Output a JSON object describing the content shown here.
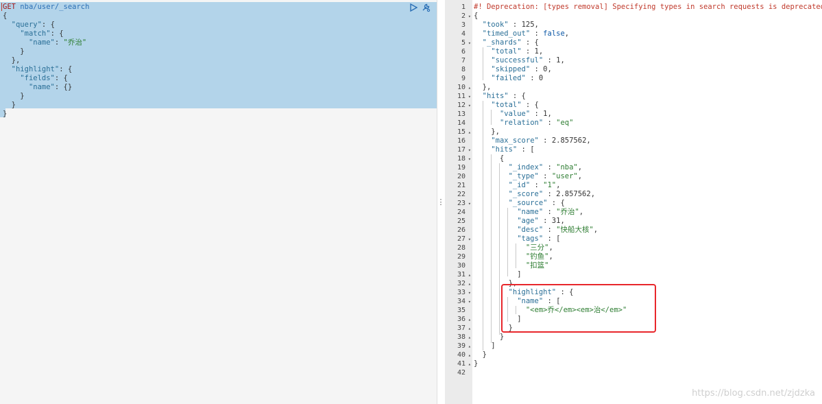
{
  "request": {
    "method": "GET",
    "url": "nba/user/_search",
    "lines": [
      [
        [
          "pun",
          "{"
        ]
      ],
      [
        [
          "pun",
          "  "
        ],
        [
          "key",
          "\"query\""
        ],
        [
          "pun",
          ": {"
        ]
      ],
      [
        [
          "pun",
          "    "
        ],
        [
          "key",
          "\"match\""
        ],
        [
          "pun",
          ": {"
        ]
      ],
      [
        [
          "pun",
          "      "
        ],
        [
          "key",
          "\"name\""
        ],
        [
          "pun",
          ": "
        ],
        [
          "str",
          "\"乔治\""
        ]
      ],
      [
        [
          "pun",
          "    }"
        ]
      ],
      [
        [
          "pun",
          "  },"
        ]
      ],
      [
        [
          "pun",
          "  "
        ],
        [
          "key",
          "\"highlight\""
        ],
        [
          "pun",
          ": {"
        ]
      ],
      [
        [
          "pun",
          "    "
        ],
        [
          "key",
          "\"fields\""
        ],
        [
          "pun",
          ": {"
        ]
      ],
      [
        [
          "pun",
          "      "
        ],
        [
          "key",
          "\"name\""
        ],
        [
          "pun",
          ": {}"
        ]
      ],
      [
        [
          "pun",
          "    }"
        ]
      ],
      [
        [
          "pun",
          "  }"
        ]
      ],
      [
        [
          "pun",
          "}"
        ]
      ]
    ]
  },
  "actions": {
    "run_icon": "play-icon",
    "settings_icon": "wrench-icon"
  },
  "splitter_glyph": "⋮",
  "response": {
    "lines": [
      {
        "n": "1",
        "fold": "",
        "t": [
          [
            "comment",
            "#! Deprecation: [types removal] Specifying types in search requests is deprecated."
          ]
        ]
      },
      {
        "n": "2",
        "fold": "▾",
        "t": [
          [
            "pun",
            "{"
          ]
        ]
      },
      {
        "n": "3",
        "fold": "",
        "t": [
          [
            "pun",
            "  "
          ],
          [
            "key",
            "\"took\""
          ],
          [
            "pun",
            " : "
          ],
          [
            "num",
            "125"
          ],
          [
            "pun",
            ","
          ]
        ]
      },
      {
        "n": "4",
        "fold": "",
        "t": [
          [
            "pun",
            "  "
          ],
          [
            "key",
            "\"timed_out\""
          ],
          [
            "pun",
            " : "
          ],
          [
            "bool",
            "false"
          ],
          [
            "pun",
            ","
          ]
        ]
      },
      {
        "n": "5",
        "fold": "▾",
        "t": [
          [
            "pun",
            "  "
          ],
          [
            "key",
            "\"_shards\""
          ],
          [
            "pun",
            " : {"
          ]
        ]
      },
      {
        "n": "6",
        "fold": "",
        "t": [
          [
            "pun",
            "    "
          ],
          [
            "key",
            "\"total\""
          ],
          [
            "pun",
            " : "
          ],
          [
            "num",
            "1"
          ],
          [
            "pun",
            ","
          ]
        ]
      },
      {
        "n": "7",
        "fold": "",
        "t": [
          [
            "pun",
            "    "
          ],
          [
            "key",
            "\"successful\""
          ],
          [
            "pun",
            " : "
          ],
          [
            "num",
            "1"
          ],
          [
            "pun",
            ","
          ]
        ]
      },
      {
        "n": "8",
        "fold": "",
        "t": [
          [
            "pun",
            "    "
          ],
          [
            "key",
            "\"skipped\""
          ],
          [
            "pun",
            " : "
          ],
          [
            "num",
            "0"
          ],
          [
            "pun",
            ","
          ]
        ]
      },
      {
        "n": "9",
        "fold": "",
        "t": [
          [
            "pun",
            "    "
          ],
          [
            "key",
            "\"failed\""
          ],
          [
            "pun",
            " : "
          ],
          [
            "num",
            "0"
          ]
        ]
      },
      {
        "n": "10",
        "fold": "▴",
        "t": [
          [
            "pun",
            "  },"
          ]
        ]
      },
      {
        "n": "11",
        "fold": "▾",
        "t": [
          [
            "pun",
            "  "
          ],
          [
            "key",
            "\"hits\""
          ],
          [
            "pun",
            " : {"
          ]
        ]
      },
      {
        "n": "12",
        "fold": "▾",
        "t": [
          [
            "pun",
            "    "
          ],
          [
            "key",
            "\"total\""
          ],
          [
            "pun",
            " : {"
          ]
        ]
      },
      {
        "n": "13",
        "fold": "",
        "t": [
          [
            "pun",
            "      "
          ],
          [
            "key",
            "\"value\""
          ],
          [
            "pun",
            " : "
          ],
          [
            "num",
            "1"
          ],
          [
            "pun",
            ","
          ]
        ]
      },
      {
        "n": "14",
        "fold": "",
        "t": [
          [
            "pun",
            "      "
          ],
          [
            "key",
            "\"relation\""
          ],
          [
            "pun",
            " : "
          ],
          [
            "str",
            "\"eq\""
          ]
        ]
      },
      {
        "n": "15",
        "fold": "▴",
        "t": [
          [
            "pun",
            "    },"
          ]
        ]
      },
      {
        "n": "16",
        "fold": "",
        "t": [
          [
            "pun",
            "    "
          ],
          [
            "key",
            "\"max_score\""
          ],
          [
            "pun",
            " : "
          ],
          [
            "num",
            "2.857562"
          ],
          [
            "pun",
            ","
          ]
        ]
      },
      {
        "n": "17",
        "fold": "▾",
        "t": [
          [
            "pun",
            "    "
          ],
          [
            "key",
            "\"hits\""
          ],
          [
            "pun",
            " : ["
          ]
        ]
      },
      {
        "n": "18",
        "fold": "▾",
        "t": [
          [
            "pun",
            "      {"
          ]
        ]
      },
      {
        "n": "19",
        "fold": "",
        "t": [
          [
            "pun",
            "        "
          ],
          [
            "key",
            "\"_index\""
          ],
          [
            "pun",
            " : "
          ],
          [
            "str",
            "\"nba\""
          ],
          [
            "pun",
            ","
          ]
        ]
      },
      {
        "n": "20",
        "fold": "",
        "t": [
          [
            "pun",
            "        "
          ],
          [
            "key",
            "\"_type\""
          ],
          [
            "pun",
            " : "
          ],
          [
            "str",
            "\"user\""
          ],
          [
            "pun",
            ","
          ]
        ]
      },
      {
        "n": "21",
        "fold": "",
        "t": [
          [
            "pun",
            "        "
          ],
          [
            "key",
            "\"_id\""
          ],
          [
            "pun",
            " : "
          ],
          [
            "str",
            "\"1\""
          ],
          [
            "pun",
            ","
          ]
        ]
      },
      {
        "n": "22",
        "fold": "",
        "t": [
          [
            "pun",
            "        "
          ],
          [
            "key",
            "\"_score\""
          ],
          [
            "pun",
            " : "
          ],
          [
            "num",
            "2.857562"
          ],
          [
            "pun",
            ","
          ]
        ]
      },
      {
        "n": "23",
        "fold": "▾",
        "t": [
          [
            "pun",
            "        "
          ],
          [
            "key",
            "\"_source\""
          ],
          [
            "pun",
            " : {"
          ]
        ]
      },
      {
        "n": "24",
        "fold": "",
        "t": [
          [
            "pun",
            "          "
          ],
          [
            "key",
            "\"name\""
          ],
          [
            "pun",
            " : "
          ],
          [
            "str",
            "\"乔治\""
          ],
          [
            "pun",
            ","
          ]
        ]
      },
      {
        "n": "25",
        "fold": "",
        "t": [
          [
            "pun",
            "          "
          ],
          [
            "key",
            "\"age\""
          ],
          [
            "pun",
            " : "
          ],
          [
            "num",
            "31"
          ],
          [
            "pun",
            ","
          ]
        ]
      },
      {
        "n": "26",
        "fold": "",
        "t": [
          [
            "pun",
            "          "
          ],
          [
            "key",
            "\"desc\""
          ],
          [
            "pun",
            " : "
          ],
          [
            "str",
            "\"快船大核\""
          ],
          [
            "pun",
            ","
          ]
        ]
      },
      {
        "n": "27",
        "fold": "▾",
        "t": [
          [
            "pun",
            "          "
          ],
          [
            "key",
            "\"tags\""
          ],
          [
            "pun",
            " : ["
          ]
        ]
      },
      {
        "n": "28",
        "fold": "",
        "t": [
          [
            "pun",
            "            "
          ],
          [
            "str",
            "\"三分\""
          ],
          [
            "pun",
            ","
          ]
        ]
      },
      {
        "n": "29",
        "fold": "",
        "t": [
          [
            "pun",
            "            "
          ],
          [
            "str",
            "\"钓鱼\""
          ],
          [
            "pun",
            ","
          ]
        ]
      },
      {
        "n": "30",
        "fold": "",
        "t": [
          [
            "pun",
            "            "
          ],
          [
            "str",
            "\"扣篮\""
          ]
        ]
      },
      {
        "n": "31",
        "fold": "▴",
        "t": [
          [
            "pun",
            "          ]"
          ]
        ]
      },
      {
        "n": "32",
        "fold": "▴",
        "t": [
          [
            "pun",
            "        },"
          ]
        ]
      },
      {
        "n": "33",
        "fold": "▾",
        "t": [
          [
            "pun",
            "        "
          ],
          [
            "key",
            "\"highlight\""
          ],
          [
            "pun",
            " : {"
          ]
        ]
      },
      {
        "n": "34",
        "fold": "▾",
        "t": [
          [
            "pun",
            "          "
          ],
          [
            "key",
            "\"name\""
          ],
          [
            "pun",
            " : ["
          ]
        ]
      },
      {
        "n": "35",
        "fold": "",
        "t": [
          [
            "pun",
            "            "
          ],
          [
            "str",
            "\"<em>乔</em><em>治</em>\""
          ]
        ]
      },
      {
        "n": "36",
        "fold": "▴",
        "t": [
          [
            "pun",
            "          ]"
          ]
        ]
      },
      {
        "n": "37",
        "fold": "▴",
        "t": [
          [
            "pun",
            "        }"
          ]
        ]
      },
      {
        "n": "38",
        "fold": "▴",
        "t": [
          [
            "pun",
            "      }"
          ]
        ]
      },
      {
        "n": "39",
        "fold": "▴",
        "t": [
          [
            "pun",
            "    ]"
          ]
        ]
      },
      {
        "n": "40",
        "fold": "▴",
        "t": [
          [
            "pun",
            "  }"
          ]
        ]
      },
      {
        "n": "41",
        "fold": "▴",
        "t": [
          [
            "pun",
            "}"
          ]
        ]
      },
      {
        "n": "42",
        "fold": "",
        "t": []
      }
    ]
  },
  "watermark": "https://blog.csdn.net/zjdzka",
  "colors": {
    "selection": "#b3d4ea",
    "annotation_box": "#e8262b"
  }
}
